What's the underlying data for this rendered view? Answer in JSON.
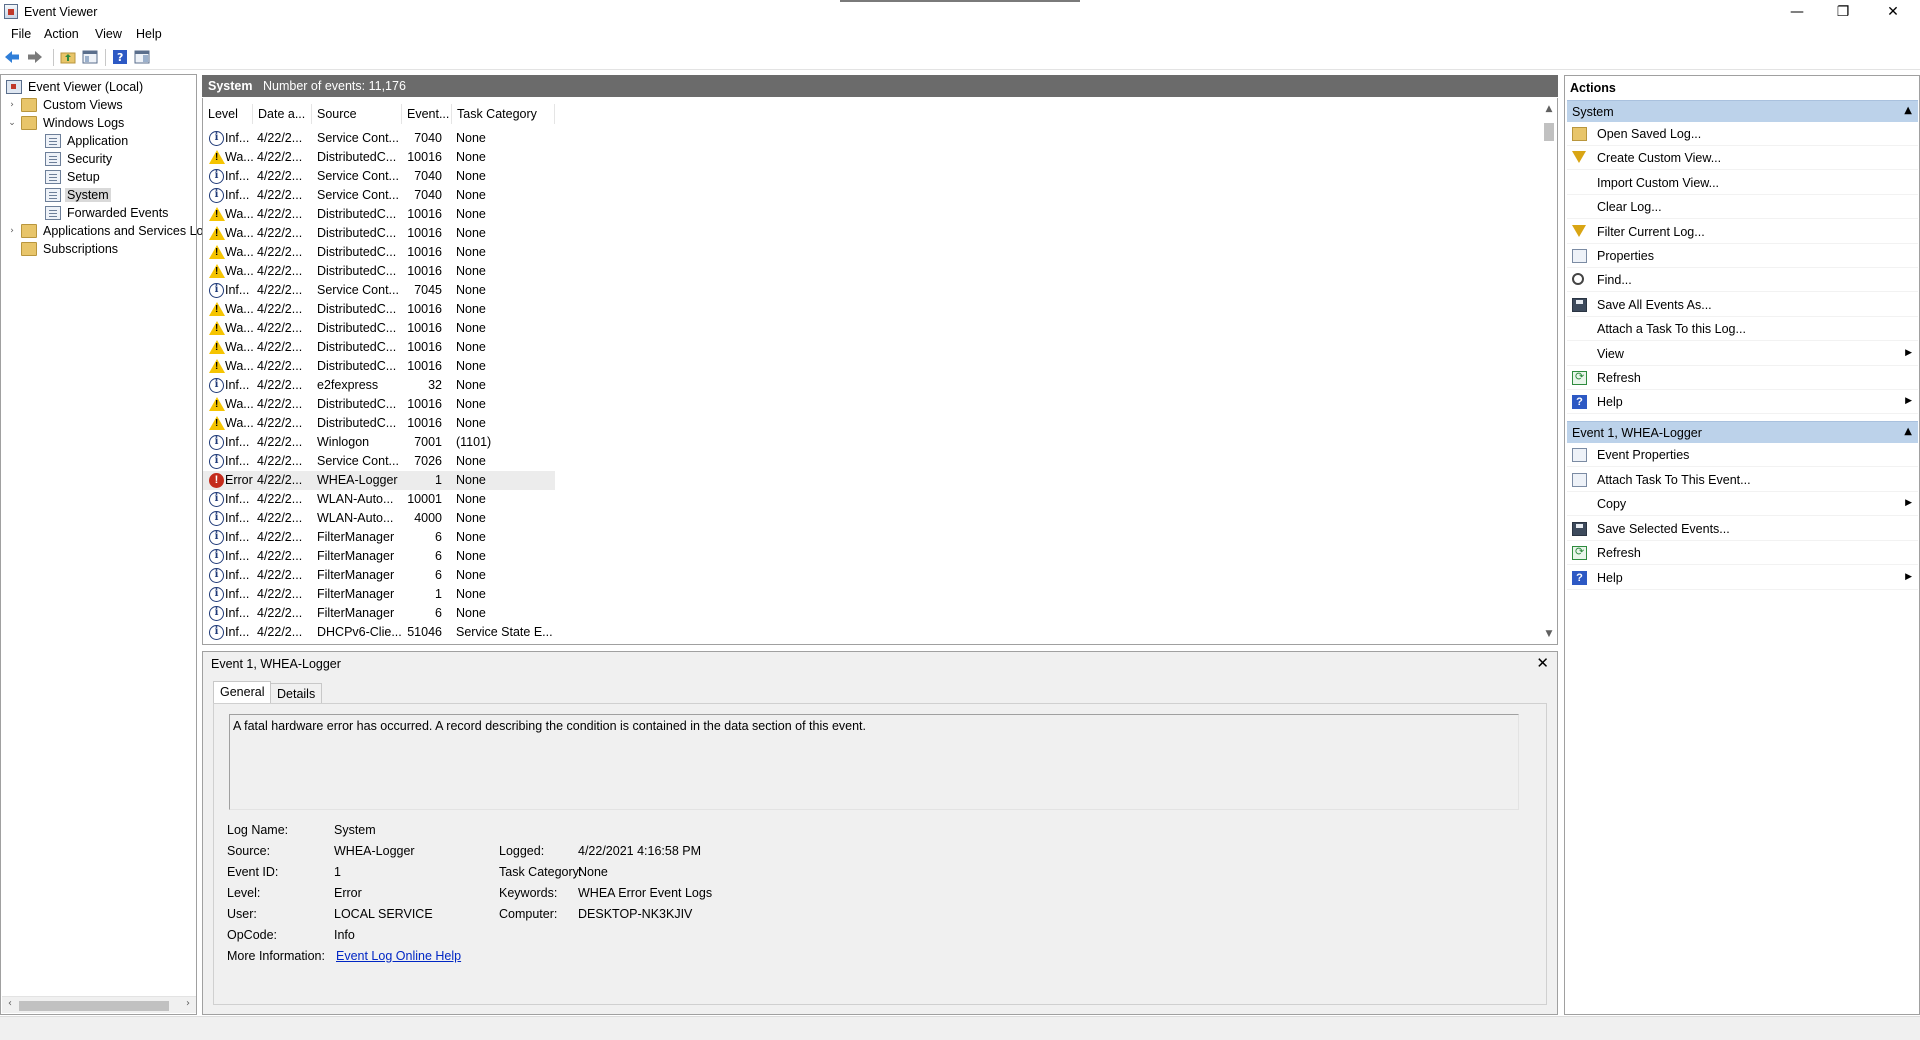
{
  "window": {
    "title": "Event Viewer",
    "controls": {
      "minimize": "—",
      "restore": "❐",
      "close": "✕"
    }
  },
  "menu": [
    "File",
    "Action",
    "View",
    "Help"
  ],
  "toolbar": [
    "back-icon",
    "forward-icon",
    "up-folder-icon",
    "console-tree-icon",
    "help-icon",
    "action-pane-icon"
  ],
  "tree": {
    "root": "Event Viewer (Local)",
    "custom_views": "Custom Views",
    "windows_logs": "Windows Logs",
    "application": "Application",
    "security": "Security",
    "setup": "Setup",
    "system": "System",
    "forwarded": "Forwarded Events",
    "apps_services": "Applications and Services Lo",
    "subscriptions": "Subscriptions"
  },
  "log_header": {
    "name": "System",
    "count": "Number of events: 11,176"
  },
  "columns": {
    "level": "Level",
    "date": "Date a...",
    "source": "Source",
    "event": "Event...",
    "task": "Task Category"
  },
  "rows": [
    {
      "type": "info",
      "level": "Inf...",
      "date": "4/22/2...",
      "source": "Service Cont...",
      "id": "7040",
      "task": "None"
    },
    {
      "type": "warn",
      "level": "Wa...",
      "date": "4/22/2...",
      "source": "DistributedC...",
      "id": "10016",
      "task": "None"
    },
    {
      "type": "info",
      "level": "Inf...",
      "date": "4/22/2...",
      "source": "Service Cont...",
      "id": "7040",
      "task": "None"
    },
    {
      "type": "info",
      "level": "Inf...",
      "date": "4/22/2...",
      "source": "Service Cont...",
      "id": "7040",
      "task": "None"
    },
    {
      "type": "warn",
      "level": "Wa...",
      "date": "4/22/2...",
      "source": "DistributedC...",
      "id": "10016",
      "task": "None"
    },
    {
      "type": "warn",
      "level": "Wa...",
      "date": "4/22/2...",
      "source": "DistributedC...",
      "id": "10016",
      "task": "None"
    },
    {
      "type": "warn",
      "level": "Wa...",
      "date": "4/22/2...",
      "source": "DistributedC...",
      "id": "10016",
      "task": "None"
    },
    {
      "type": "warn",
      "level": "Wa...",
      "date": "4/22/2...",
      "source": "DistributedC...",
      "id": "10016",
      "task": "None"
    },
    {
      "type": "info",
      "level": "Inf...",
      "date": "4/22/2...",
      "source": "Service Cont...",
      "id": "7045",
      "task": "None"
    },
    {
      "type": "warn",
      "level": "Wa...",
      "date": "4/22/2...",
      "source": "DistributedC...",
      "id": "10016",
      "task": "None"
    },
    {
      "type": "warn",
      "level": "Wa...",
      "date": "4/22/2...",
      "source": "DistributedC...",
      "id": "10016",
      "task": "None"
    },
    {
      "type": "warn",
      "level": "Wa...",
      "date": "4/22/2...",
      "source": "DistributedC...",
      "id": "10016",
      "task": "None"
    },
    {
      "type": "warn",
      "level": "Wa...",
      "date": "4/22/2...",
      "source": "DistributedC...",
      "id": "10016",
      "task": "None"
    },
    {
      "type": "info",
      "level": "Inf...",
      "date": "4/22/2...",
      "source": "e2fexpress",
      "id": "32",
      "task": "None"
    },
    {
      "type": "warn",
      "level": "Wa...",
      "date": "4/22/2...",
      "source": "DistributedC...",
      "id": "10016",
      "task": "None"
    },
    {
      "type": "warn",
      "level": "Wa...",
      "date": "4/22/2...",
      "source": "DistributedC...",
      "id": "10016",
      "task": "None"
    },
    {
      "type": "info",
      "level": "Inf...",
      "date": "4/22/2...",
      "source": "Winlogon",
      "id": "7001",
      "task": "(1101)"
    },
    {
      "type": "info",
      "level": "Inf...",
      "date": "4/22/2...",
      "source": "Service Cont...",
      "id": "7026",
      "task": "None"
    },
    {
      "type": "error",
      "level": "Error",
      "date": "4/22/2...",
      "source": "WHEA-Logger",
      "id": "1",
      "task": "None"
    },
    {
      "type": "info",
      "level": "Inf...",
      "date": "4/22/2...",
      "source": "WLAN-Auto...",
      "id": "10001",
      "task": "None"
    },
    {
      "type": "info",
      "level": "Inf...",
      "date": "4/22/2...",
      "source": "WLAN-Auto...",
      "id": "4000",
      "task": "None"
    },
    {
      "type": "info",
      "level": "Inf...",
      "date": "4/22/2...",
      "source": "FilterManager",
      "id": "6",
      "task": "None"
    },
    {
      "type": "info",
      "level": "Inf...",
      "date": "4/22/2...",
      "source": "FilterManager",
      "id": "6",
      "task": "None"
    },
    {
      "type": "info",
      "level": "Inf...",
      "date": "4/22/2...",
      "source": "FilterManager",
      "id": "6",
      "task": "None"
    },
    {
      "type": "info",
      "level": "Inf...",
      "date": "4/22/2...",
      "source": "FilterManager",
      "id": "1",
      "task": "None"
    },
    {
      "type": "info",
      "level": "Inf...",
      "date": "4/22/2...",
      "source": "FilterManager",
      "id": "6",
      "task": "None"
    },
    {
      "type": "info",
      "level": "Inf...",
      "date": "4/22/2...",
      "source": "DHCPv6-Clie...",
      "id": "51046",
      "task": "Service State E..."
    }
  ],
  "detail": {
    "title": "Event 1, WHEA-Logger",
    "close": "✕",
    "tabs": [
      "General",
      "Details"
    ],
    "description": "A fatal hardware error has occurred. A record describing the condition is contained in the data section of this event.",
    "labels": {
      "log_name": "Log Name:",
      "source": "Source:",
      "event_id": "Event ID:",
      "level": "Level:",
      "user": "User:",
      "opcode": "OpCode:",
      "more_info": "More Information:",
      "logged": "Logged:",
      "task_category": "Task Category:",
      "keywords": "Keywords:",
      "computer": "Computer:"
    },
    "values": {
      "log_name": "System",
      "source": "WHEA-Logger",
      "event_id": "1",
      "level": "Error",
      "user": "LOCAL SERVICE",
      "opcode": "Info",
      "more_info": "Event Log Online Help",
      "logged": "4/22/2021 4:16:58 PM",
      "task_category": "None",
      "keywords": "WHEA Error Event Logs",
      "computer": "DESKTOP-NK3KJIV"
    }
  },
  "actions": {
    "title": "Actions",
    "section1": {
      "title": "System",
      "items": [
        {
          "label": "Open Saved Log...",
          "icon": "open-folder-icon"
        },
        {
          "label": "Create Custom View...",
          "icon": "filter-icon"
        },
        {
          "label": "Import Custom View...",
          "icon": ""
        },
        {
          "label": "Clear Log...",
          "icon": ""
        },
        {
          "label": "Filter Current Log...",
          "icon": "filter-icon"
        },
        {
          "label": "Properties",
          "icon": "properties-icon"
        },
        {
          "label": "Find...",
          "icon": "binoculars-icon"
        },
        {
          "label": "Save All Events As...",
          "icon": "save-icon"
        },
        {
          "label": "Attach a Task To this Log...",
          "icon": ""
        },
        {
          "label": "View",
          "icon": "",
          "submenu": true
        },
        {
          "label": "Refresh",
          "icon": "refresh-icon"
        },
        {
          "label": "Help",
          "icon": "help-icon",
          "submenu": true
        }
      ]
    },
    "section2": {
      "title": "Event 1, WHEA-Logger",
      "items": [
        {
          "label": "Event Properties",
          "icon": "properties-icon"
        },
        {
          "label": "Attach Task To This Event...",
          "icon": "task-icon"
        },
        {
          "label": "Copy",
          "icon": "",
          "submenu": true
        },
        {
          "label": "Save Selected Events...",
          "icon": "save-icon"
        },
        {
          "label": "Refresh",
          "icon": "refresh-icon"
        },
        {
          "label": "Help",
          "icon": "help-icon",
          "submenu": true
        }
      ]
    }
  },
  "colors": {
    "section_header": "#bcd2ea",
    "log_header": "#6b6b6b",
    "link": "#0026c4",
    "error": "#c42b1c",
    "warning": "#f5c400"
  }
}
